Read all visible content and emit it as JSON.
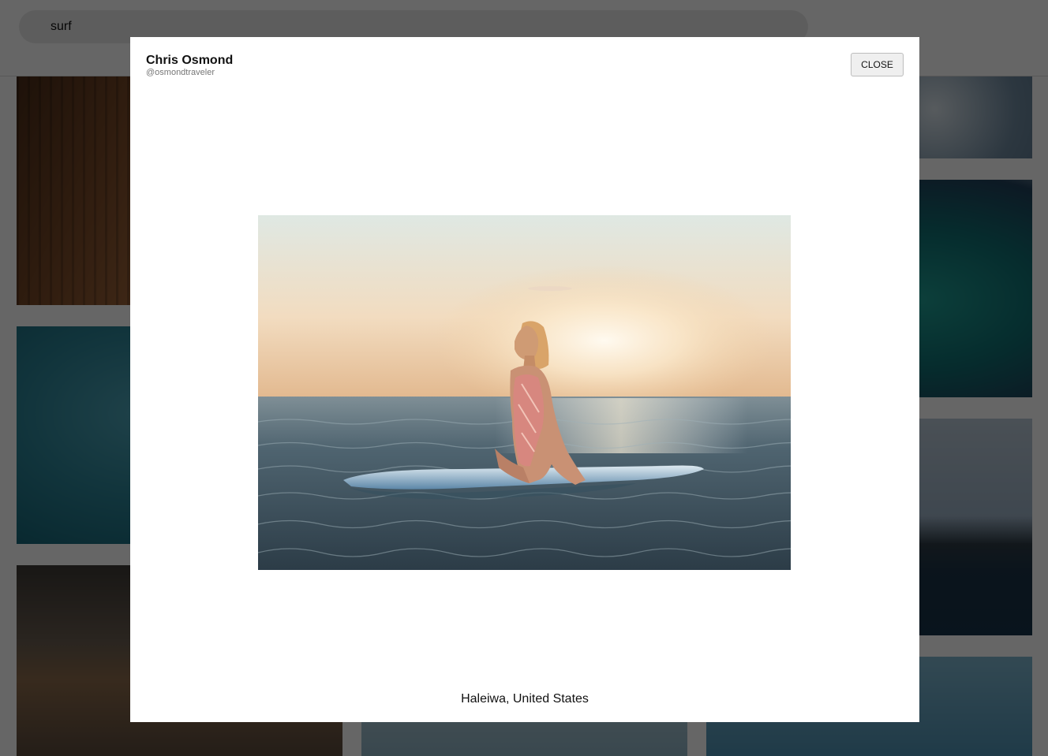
{
  "search": {
    "value": "surf"
  },
  "modal": {
    "author_name": "Chris Osmond",
    "author_handle": "@osmondtraveler",
    "close_label": "CLOSE",
    "location": "Haleiwa, United States"
  },
  "colors": {
    "overlay": "rgba(0,0,0,0.6)",
    "modal_background": "#ffffff",
    "search_background": "#e9e9e9"
  }
}
